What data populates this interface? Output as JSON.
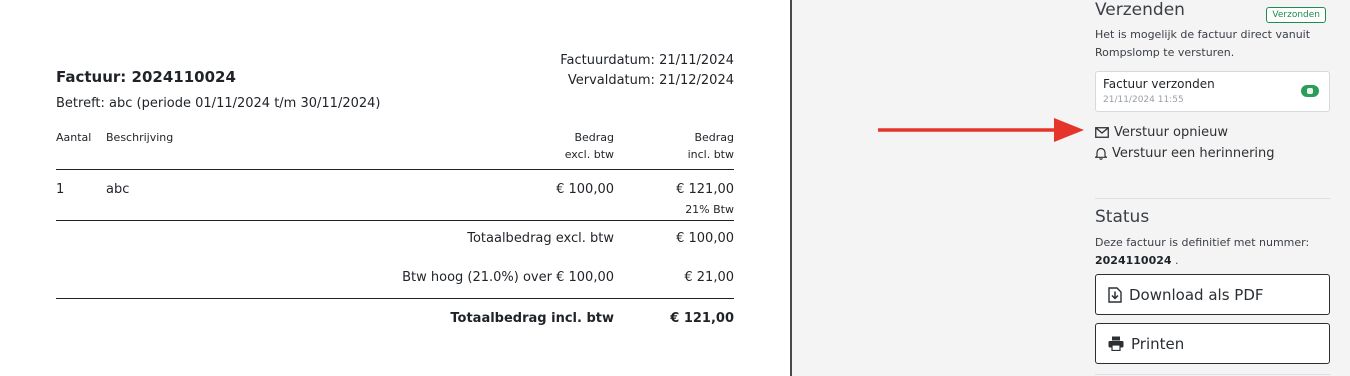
{
  "invoice": {
    "invoice_date": "Factuurdatum: 21/11/2024",
    "due_date": "Vervaldatum: 21/12/2024",
    "title": "Factuur: 2024110024",
    "subject": "Betreft: abc (periode 01/11/2024 t/m 30/11/2024)",
    "columns": {
      "qty": "Aantal",
      "desc": "Beschrijving",
      "excl_1": "Bedrag",
      "excl_2": "excl. btw",
      "incl_1": "Bedrag",
      "incl_2": "incl. btw"
    },
    "items": [
      {
        "qty": "1",
        "desc": "abc",
        "excl": "€ 100,00",
        "incl": "€ 121,00",
        "vat": "21% Btw"
      }
    ],
    "totals": {
      "subtotal_label": "Totaalbedrag excl. btw",
      "subtotal_value": "€ 100,00",
      "vat_label": "Btw hoog (21.0%) over € 100,00",
      "vat_value": "€ 21,00",
      "total_label": "Totaalbedrag incl. btw",
      "total_value": "€ 121,00"
    }
  },
  "panel": {
    "send": {
      "title": "Verzenden",
      "badge": "Verzonden",
      "description": "Het is mogelijk de factuur direct vanuit Rompslomp te versturen.",
      "sent_card": {
        "title": "Factuur verzonden",
        "time": "21/11/2024 11:55"
      },
      "resend": "Verstuur opnieuw",
      "reminder": "Verstuur een herinnering"
    },
    "status": {
      "title": "Status",
      "description": "Deze factuur is definitief met nummer:",
      "number": "2024110024",
      "number_suffix": " .",
      "download_button": "Download als PDF",
      "print_button": "Printen"
    }
  },
  "colors": {
    "accent_green": "#1e8c4d",
    "annotation_arrow": "#e5342a",
    "panel_background": "#f4f4f4"
  }
}
